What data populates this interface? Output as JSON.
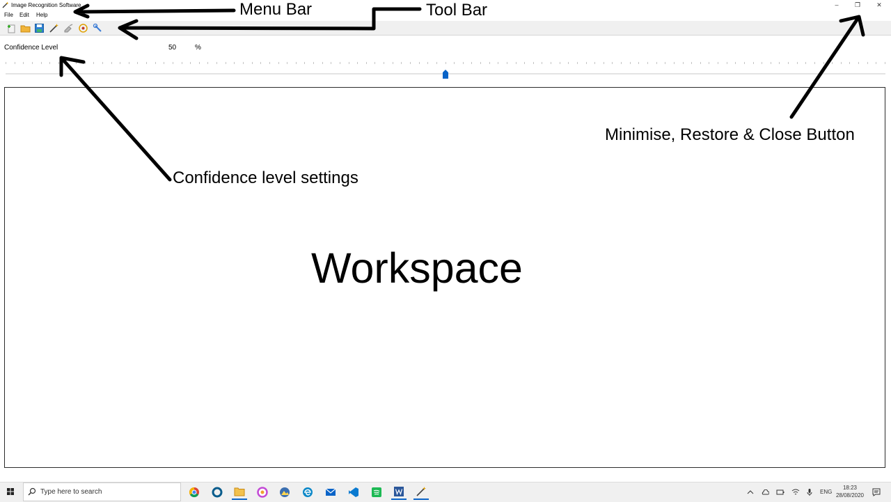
{
  "window": {
    "title": "Image Recognition Software",
    "controls": {
      "minimise": "–",
      "restore": "❐",
      "close": "✕"
    }
  },
  "menu": {
    "items": [
      "File",
      "Edit",
      "Help"
    ]
  },
  "toolbar": {
    "tools": [
      "new-icon",
      "open-folder-icon",
      "save-icon",
      "magic-wand-icon",
      "clear-icon",
      "detect-icon",
      "settings-wrench-icon"
    ]
  },
  "confidence": {
    "label": "Confidence Level",
    "value": "50",
    "unit": "%",
    "slider_fraction": 0.5
  },
  "workspace": {
    "label": "Workspace"
  },
  "annotations": {
    "menu_bar": "Menu Bar",
    "tool_bar": "Tool Bar",
    "window_buttons": "Minimise, Restore & Close Button",
    "confidence_settings": "Confidence level settings"
  },
  "taskbar": {
    "search_placeholder": "Type here to search",
    "apps": [
      "chrome-icon",
      "cortana-icon",
      "file-explorer-icon",
      "app-icon",
      "photos-icon",
      "edge-icon",
      "mail-icon",
      "vscode-icon",
      "spotify-icon",
      "word-icon",
      "magic-wand-app-icon"
    ],
    "language": "ENG",
    "time": "18:23",
    "date": "28/08/2020",
    "accent": "#0a64c8"
  }
}
